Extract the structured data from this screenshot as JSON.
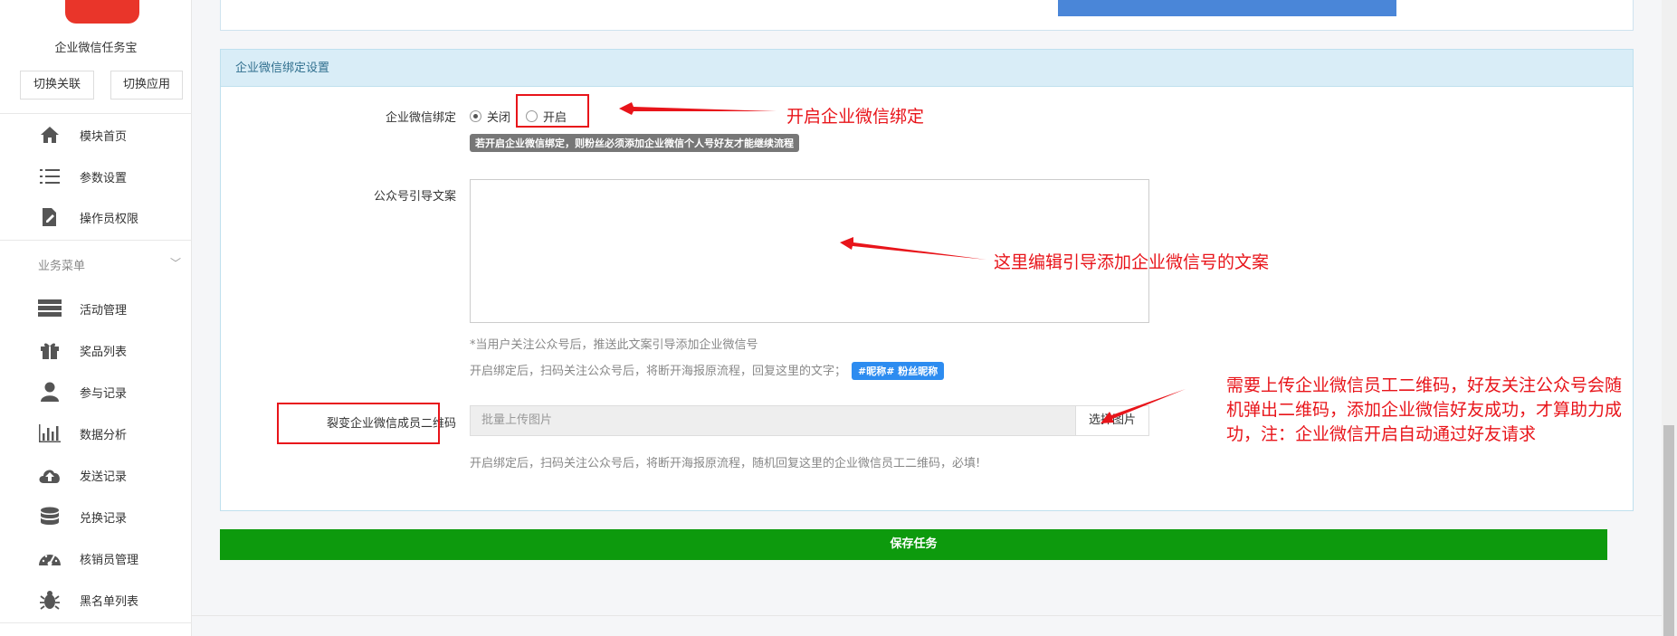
{
  "sidebar": {
    "app_name": "企业微信任务宝",
    "switch_link_label": "切换关联",
    "switch_app_label": "切换应用",
    "menu_top": [
      {
        "label": "模块首页",
        "icon": "home-icon"
      },
      {
        "label": "参数设置",
        "icon": "list-icon"
      },
      {
        "label": "操作员权限",
        "icon": "document-edit-icon"
      }
    ],
    "section_title": "业务菜单",
    "menu_business": [
      {
        "label": "活动管理",
        "icon": "server-icon"
      },
      {
        "label": "奖品列表",
        "icon": "gift-icon"
      },
      {
        "label": "参与记录",
        "icon": "user-icon"
      },
      {
        "label": "数据分析",
        "icon": "bar-chart-icon"
      },
      {
        "label": "发送记录",
        "icon": "cloud-upload-icon"
      },
      {
        "label": "兑换记录",
        "icon": "database-icon"
      },
      {
        "label": "核销员管理",
        "icon": "dashboard-icon"
      },
      {
        "label": "黑名单列表",
        "icon": "bug-icon"
      }
    ]
  },
  "panel": {
    "title": "企业微信绑定设置",
    "bind": {
      "label": "企业微信绑定",
      "option_off": "关闭",
      "option_on": "开启",
      "selected": "关闭",
      "tip": "若开启企业微信绑定，则粉丝必须添加企业微信个人号好友才能继续流程"
    },
    "guide": {
      "label": "公众号引导文案",
      "value": "",
      "help1": "*当用户关注公众号后，推送此文案引导添加企业微信号",
      "help2": "开启绑定后，扫码关注公众号后，将断开海报原流程，回复这里的文字；",
      "fans_tag": "#昵称# 粉丝昵称"
    },
    "qrcode": {
      "label": "裂变企业微信成员二维码",
      "placeholder": "批量上传图片",
      "button": "选择图片",
      "help": "开启绑定后，扫码关注公众号后，将断开海报原流程，随机回复这里的企业微信员工二维码，必填!"
    }
  },
  "save_label": "保存任务",
  "annotations": {
    "a1": "开启企业微信绑定",
    "a2": "这里编辑引导添加企业微信号的文案",
    "a3": [
      "需要上传企业微信员工二维码，好友关注公众号会随",
      "机弹出二维码，添加企业微信好友成功，才算助力成",
      "功，注：企业微信开启自动通过好友请求"
    ]
  },
  "colors": {
    "annotation_red": "#e8141a",
    "save_green": "#0d9a0d",
    "panel_head_bg": "#d9edf7",
    "tag_blue": "#2d8cf0"
  }
}
